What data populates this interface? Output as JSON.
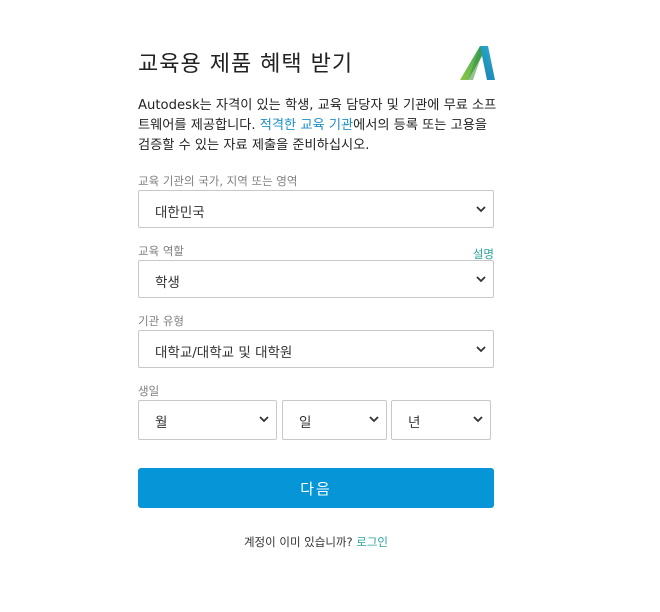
{
  "title": "교육용 제품 혜택 받기",
  "intro": {
    "text_before": "Autodesk는 자격이 있는 학생, 교육 담당자 및 기관에 무료 소프트웨어를 제공합니다. ",
    "link": "적격한 교육 기관",
    "text_after": "에서의 등록 또는 고용을 검증할 수 있는 자료 제출을 준비하십시오."
  },
  "country": {
    "label": "교육 기관의 국가, 지역 또는 영역",
    "value": "대한민국"
  },
  "role": {
    "label": "교육 역할",
    "help": "설명",
    "value": "학생"
  },
  "institution_type": {
    "label": "기관 유형",
    "value": "대학교/대학교 및 대학원"
  },
  "dob": {
    "label": "생일",
    "month": "월",
    "day": "일",
    "year": "년"
  },
  "next_button": "다음",
  "signin": {
    "prompt": "계정이 이미 있습니까? ",
    "link": "로그인"
  },
  "colors": {
    "primary": "#0696d7",
    "link": "#1e8fc6",
    "teal_link": "#2aa39a"
  }
}
